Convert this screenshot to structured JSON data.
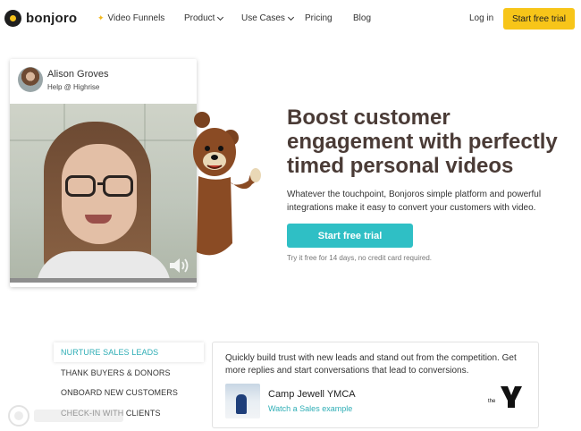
{
  "brand": {
    "name": "bonjoro"
  },
  "nav": {
    "items": [
      {
        "label": "Video Funnels",
        "icon": "sparkle-icon"
      },
      {
        "label": "Product",
        "dropdown": true
      },
      {
        "label": "Use Cases",
        "dropdown": true
      },
      {
        "label": "Pricing"
      },
      {
        "label": "Blog"
      }
    ],
    "login": "Log in",
    "cta": "Start free trial"
  },
  "video_card": {
    "name": "Alison Groves",
    "role": "Help @ Highrise",
    "progress": 0
  },
  "hero": {
    "title": "Boost customer engagement with perfectly timed personal videos",
    "subtitle": "Whatever the touchpoint, Bonjoros simple platform and powerful integrations make it easy to convert your customers with video.",
    "button": "Start free trial",
    "note": "Try it free for 14 days, no credit card required."
  },
  "use_cases": {
    "tabs": [
      {
        "label": "NURTURE SALES LEADS",
        "active": true
      },
      {
        "label": "THANK BUYERS & DONORS",
        "active": false
      },
      {
        "label": "ONBOARD NEW CUSTOMERS",
        "active": false
      },
      {
        "label": "CHECK-IN WITH CLIENTS",
        "active": false
      }
    ],
    "panel": {
      "text": "Quickly build trust with new leads and stand out from the competition. Get more replies and start conversations that lead to conversions.",
      "case_title": "Camp Jewell YMCA",
      "case_link": "Watch a Sales example",
      "partner_logo": "the Y"
    }
  },
  "colors": {
    "accent_yellow": "#f7c519",
    "accent_teal": "#2fbfc5",
    "link_teal": "#2faeb6",
    "title_brown": "#4a3b36"
  }
}
